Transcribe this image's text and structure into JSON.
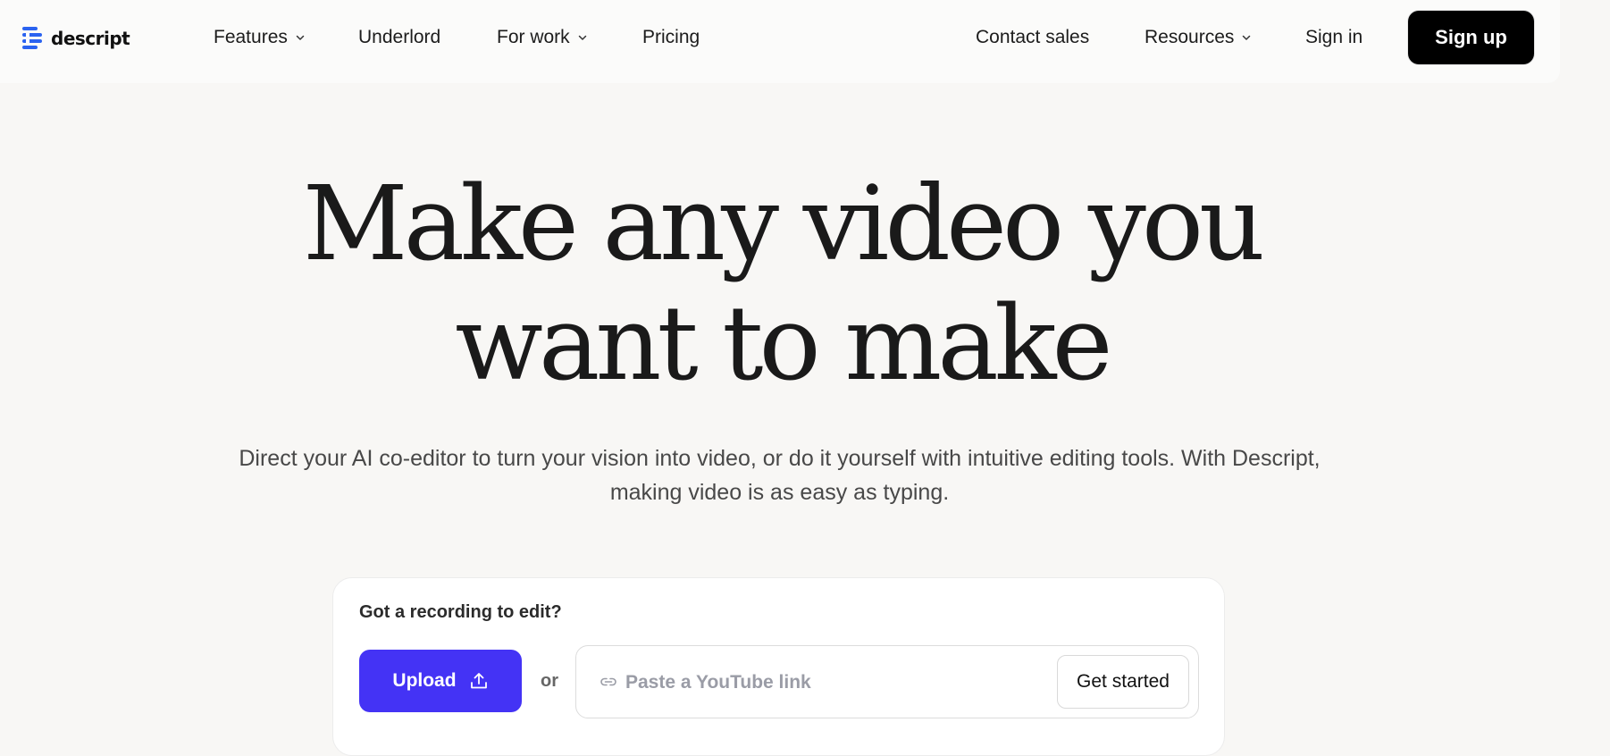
{
  "brand": {
    "name": "descript",
    "accent": "#2b63f0"
  },
  "nav": {
    "left_items": [
      {
        "label": "Features",
        "has_dropdown": true
      },
      {
        "label": "Underlord",
        "has_dropdown": false
      },
      {
        "label": "For work",
        "has_dropdown": true
      },
      {
        "label": "Pricing",
        "has_dropdown": false
      }
    ],
    "right_items": [
      {
        "label": "Contact sales",
        "has_dropdown": false
      },
      {
        "label": "Resources",
        "has_dropdown": true
      },
      {
        "label": "Sign in",
        "has_dropdown": false
      }
    ],
    "cta_label": "Sign up"
  },
  "hero": {
    "title_line1": "Make any video you",
    "title_line2": "want to make",
    "subtitle": "Direct your AI co-editor to turn your vision into video, or do it yourself with intuitive editing tools. With Descript, making video is as easy as typing."
  },
  "card": {
    "label": "Got a recording to edit?",
    "upload_label": "Upload",
    "or_text": "or",
    "link_placeholder": "Paste a YouTube link",
    "link_value": "",
    "submit_label": "Get started",
    "upload_color": "#4433f5"
  },
  "icons": {
    "chevron": "chevron-down-icon",
    "upload": "upload-icon",
    "link": "link-icon"
  }
}
